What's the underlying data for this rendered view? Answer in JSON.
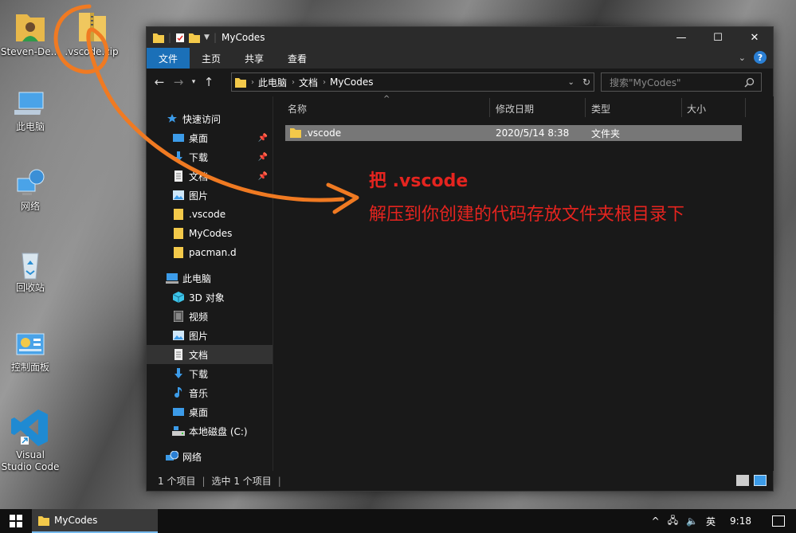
{
  "desktop": {
    "icons": [
      {
        "label": "Steven-De..."
      },
      {
        "label": ".vscode.zip"
      },
      {
        "label": "此电脑"
      },
      {
        "label": "网络"
      },
      {
        "label": "回收站"
      },
      {
        "label": "控制面板"
      },
      {
        "label": "Visual Studio Code"
      }
    ]
  },
  "window": {
    "title": "MyCodes",
    "tabs": [
      "文件",
      "主页",
      "共享",
      "查看"
    ],
    "active_tab": "文件",
    "breadcrumb": [
      "此电脑",
      "文档",
      "MyCodes"
    ],
    "search_placeholder": "搜索\"MyCodes\"",
    "nav": [
      {
        "label": "快速访问",
        "icon": "star-icon",
        "pinned": false,
        "section": true
      },
      {
        "label": "桌面",
        "icon": "desktop-folder-icon",
        "pinned": true
      },
      {
        "label": "下载",
        "icon": "download-icon",
        "pinned": true
      },
      {
        "label": "文档",
        "icon": "document-icon",
        "pinned": true
      },
      {
        "label": "图片",
        "icon": "picture-icon",
        "pinned": false
      },
      {
        "label": ".vscode",
        "icon": "folder-icon",
        "pinned": false
      },
      {
        "label": "MyCodes",
        "icon": "folder-icon",
        "pinned": false
      },
      {
        "label": "pacman.d",
        "icon": "folder-icon",
        "pinned": false
      },
      {
        "label": "此电脑",
        "icon": "computer-icon",
        "pinned": false,
        "section": true
      },
      {
        "label": "3D 对象",
        "icon": "cube-icon",
        "pinned": false
      },
      {
        "label": "视频",
        "icon": "video-icon",
        "pinned": false
      },
      {
        "label": "图片",
        "icon": "picture-icon",
        "pinned": false
      },
      {
        "label": "文档",
        "icon": "document-icon",
        "pinned": false,
        "selected": true
      },
      {
        "label": "下载",
        "icon": "download-icon",
        "pinned": false
      },
      {
        "label": "音乐",
        "icon": "music-icon",
        "pinned": false
      },
      {
        "label": "桌面",
        "icon": "desktop-folder-icon",
        "pinned": false
      },
      {
        "label": "本地磁盘 (C:)",
        "icon": "disk-icon",
        "pinned": false
      },
      {
        "label": "网络",
        "icon": "network-icon",
        "pinned": false,
        "section": true
      }
    ],
    "columns": [
      "名称",
      "修改日期",
      "类型",
      "大小"
    ],
    "files": [
      {
        "name": ".vscode",
        "date": "2020/5/14 8:38",
        "type": "文件夹",
        "size": ""
      }
    ],
    "status": {
      "count": "1 个项目",
      "selected": "选中 1 个项目"
    }
  },
  "annotation": {
    "line1": "把 .vscode",
    "line2": "解压到你创建的代码存放文件夹根目录下",
    "color": "#e5241f",
    "arrow_color": "#f07a22"
  },
  "taskbar": {
    "task_label": "MyCodes",
    "ime": "英",
    "time": "9:18"
  }
}
